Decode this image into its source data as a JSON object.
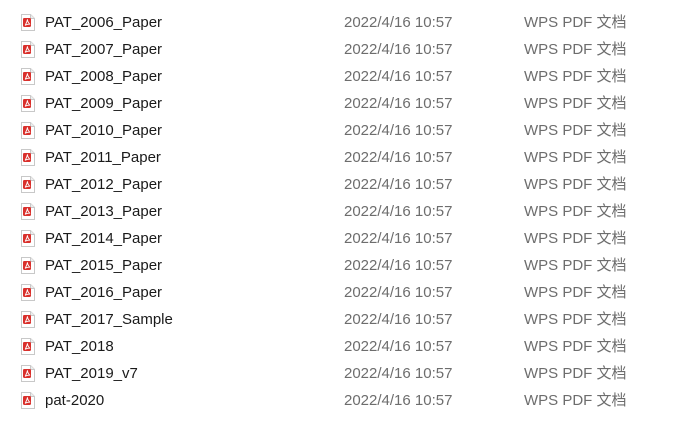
{
  "files": [
    {
      "name": "PAT_2006_Paper",
      "modified": "2022/4/16 10:57",
      "type": "WPS PDF 文档",
      "icon": "pdf-file-icon"
    },
    {
      "name": "PAT_2007_Paper",
      "modified": "2022/4/16 10:57",
      "type": "WPS PDF 文档",
      "icon": "pdf-file-icon"
    },
    {
      "name": "PAT_2008_Paper",
      "modified": "2022/4/16 10:57",
      "type": "WPS PDF 文档",
      "icon": "pdf-file-icon"
    },
    {
      "name": "PAT_2009_Paper",
      "modified": "2022/4/16 10:57",
      "type": "WPS PDF 文档",
      "icon": "pdf-file-icon"
    },
    {
      "name": "PAT_2010_Paper",
      "modified": "2022/4/16 10:57",
      "type": "WPS PDF 文档",
      "icon": "pdf-file-icon"
    },
    {
      "name": "PAT_2011_Paper",
      "modified": "2022/4/16 10:57",
      "type": "WPS PDF 文档",
      "icon": "pdf-file-icon"
    },
    {
      "name": "PAT_2012_Paper",
      "modified": "2022/4/16 10:57",
      "type": "WPS PDF 文档",
      "icon": "pdf-file-icon"
    },
    {
      "name": "PAT_2013_Paper",
      "modified": "2022/4/16 10:57",
      "type": "WPS PDF 文档",
      "icon": "pdf-file-icon"
    },
    {
      "name": "PAT_2014_Paper",
      "modified": "2022/4/16 10:57",
      "type": "WPS PDF 文档",
      "icon": "pdf-file-icon"
    },
    {
      "name": "PAT_2015_Paper",
      "modified": "2022/4/16 10:57",
      "type": "WPS PDF 文档",
      "icon": "pdf-file-icon"
    },
    {
      "name": "PAT_2016_Paper",
      "modified": "2022/4/16 10:57",
      "type": "WPS PDF 文档",
      "icon": "pdf-file-icon"
    },
    {
      "name": "PAT_2017_Sample",
      "modified": "2022/4/16 10:57",
      "type": "WPS PDF 文档",
      "icon": "pdf-file-icon"
    },
    {
      "name": "PAT_2018",
      "modified": "2022/4/16 10:57",
      "type": "WPS PDF 文档",
      "icon": "pdf-file-icon"
    },
    {
      "name": "PAT_2019_v7",
      "modified": "2022/4/16 10:57",
      "type": "WPS PDF 文档",
      "icon": "pdf-file-icon"
    },
    {
      "name": "pat-2020",
      "modified": "2022/4/16 10:57",
      "type": "WPS PDF 文档",
      "icon": "pdf-file-icon"
    }
  ],
  "colors": {
    "icon_red": "#d9302c",
    "icon_page": "#ffffff",
    "icon_border": "#c8c8c8",
    "name_text": "#1a1a1a",
    "meta_text": "#6d6d6d"
  }
}
